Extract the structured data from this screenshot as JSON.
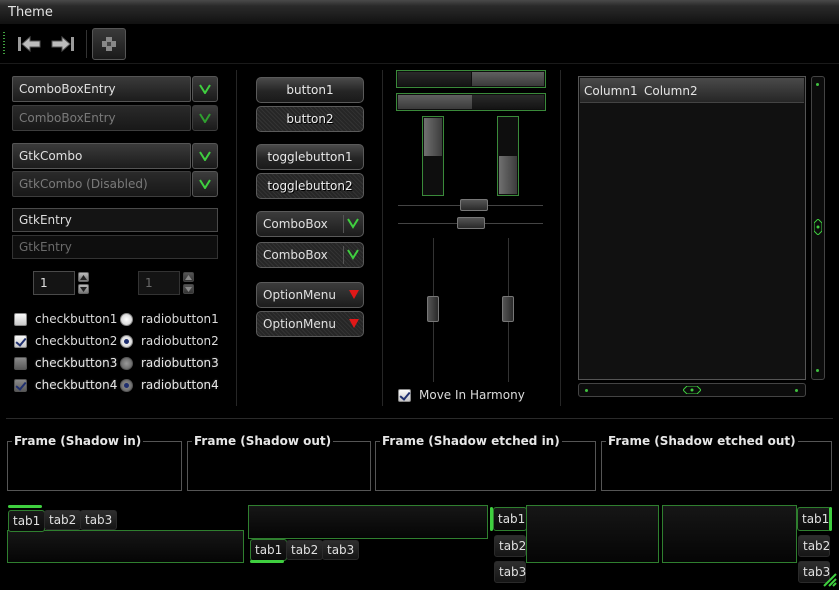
{
  "menubar": {
    "theme": "Theme"
  },
  "combos": {
    "entry1": "ComboBoxEntry",
    "entry2": "ComboBoxEntry",
    "gtkcombo1": "GtkCombo",
    "gtkcombo2": "GtkCombo (Disabled)"
  },
  "entries": {
    "entry1": "GtkEntry",
    "entry2": "GtkEntry"
  },
  "spins": {
    "spin1": "1",
    "spin2": "1"
  },
  "checks": {
    "c1": "checkbutton1",
    "c2": "checkbutton2",
    "c3": "checkbutton3",
    "c4": "checkbutton4",
    "r1": "radiobutton1",
    "r2": "radiobutton2",
    "r3": "radiobutton3",
    "r4": "radiobutton4"
  },
  "buttons": {
    "button1": "button1",
    "button2": "button2",
    "toggle1": "togglebutton1",
    "toggle2": "togglebutton2",
    "combobox1": "ComboBox",
    "combobox2": "ComboBox",
    "option1": "OptionMenu",
    "option2": "OptionMenu"
  },
  "scales": {
    "move_in_harmony": "Move In Harmony",
    "hscale1": 0.5,
    "hscale2": 0.5,
    "vbar1": 0.5,
    "vbar2": 0.5,
    "hslider1": 0.5,
    "hslider2": 0.5,
    "vslider1": 0.5,
    "vslider2": 0.5
  },
  "tree": {
    "col1": "Column1",
    "col2": "Column2"
  },
  "frames": {
    "f1": "Frame (Shadow in)",
    "f2": "Frame (Shadow out)",
    "f3": "Frame (Shadow etched in)",
    "f4": "Frame (Shadow etched out)"
  },
  "notebooks": {
    "tabs": [
      "tab1",
      "tab2",
      "tab3"
    ]
  },
  "colors": {
    "accent_green": "#3fcf3f",
    "arrow_red": "#e01818",
    "background": "#000000"
  },
  "icons": [
    "back-icon",
    "forward-icon",
    "toolbar-item-icon",
    "chevron-down-icon",
    "resize-grip-icon"
  ]
}
